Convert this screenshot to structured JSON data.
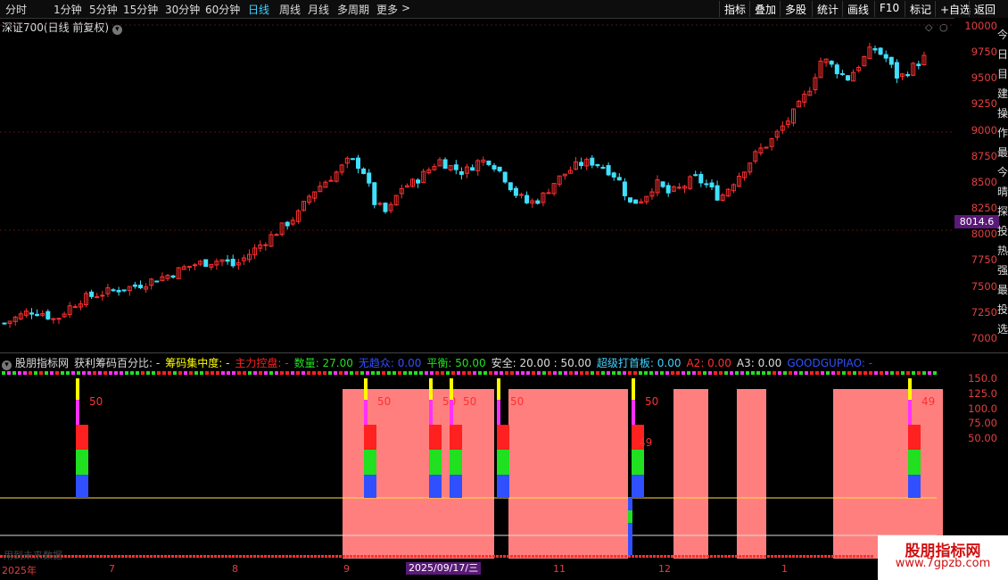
{
  "toolbar": {
    "periods": [
      "分时",
      "1分钟",
      "5分钟",
      "15分钟",
      "30分钟",
      "60分钟",
      "日线",
      "周线",
      "月线",
      "多周期",
      "更多"
    ],
    "more_arrow": ">",
    "active_period": "日线",
    "right_buttons": [
      "指标",
      "叠加",
      "多股",
      "统计",
      "画线",
      "F10",
      "标记",
      "+自选",
      "返回"
    ]
  },
  "main_chart": {
    "title": "深证700(日线 前复权)",
    "y_ticks": [
      "10000",
      "9750",
      "9500",
      "9250",
      "9000",
      "8750",
      "8500",
      "8250",
      "8000",
      "7750",
      "7500",
      "7250",
      "7000"
    ],
    "current_price": "8014.6",
    "side_glyphs": [
      "今",
      "日",
      "目",
      "建",
      "操",
      "作",
      "最",
      "今",
      "晴",
      "探",
      "投",
      "热",
      "强",
      "最",
      "投",
      "选"
    ]
  },
  "indicator": {
    "title_parts": [
      {
        "text": "股朋指标网",
        "color": "#dddddd"
      },
      {
        "text": "获利筹码百分比: -",
        "color": "#dddddd"
      },
      {
        "text": "筹码集中度: -",
        "color": "#ffff00"
      },
      {
        "text": "主力控盘: -",
        "color": "#ff2020"
      },
      {
        "text": "数量: 27.00",
        "color": "#20e020"
      },
      {
        "text": "无趋众: 0.00",
        "color": "#3050ff"
      },
      {
        "text": "平衡: 50.00",
        "color": "#20e020"
      },
      {
        "text": "安全: 20.00 : 50.00",
        "color": "#dddddd"
      },
      {
        "text": "超级打首板: 0.00",
        "color": "#3fd1ff"
      },
      {
        "text": "A2: 0.00",
        "color": "#ff3030"
      },
      {
        "text": "A3: 0.00",
        "color": "#dddddd"
      },
      {
        "text": "GOODGUPIAO: -",
        "color": "#3050ff"
      }
    ],
    "y_ticks": [
      "150.0",
      "125.0",
      "100.0",
      "75.00",
      "50.00"
    ],
    "bar_labels": [
      "50",
      "50",
      "50",
      "50",
      "50",
      "50",
      "49",
      "50"
    ],
    "faint_text": "用到未来数据"
  },
  "date_axis": {
    "labels": [
      "2025年",
      "7",
      "8",
      "9",
      "2025/09/17/三",
      "11",
      "12",
      "1"
    ],
    "highlight": "2025/09/17/三"
  },
  "watermark": {
    "line1": "股朋指标网",
    "line2": "www.7gpzb.com"
  },
  "chart_data": {
    "type": "candlestick",
    "y_range": [
      6930,
      10050
    ],
    "up_color": "#ff3030",
    "down_color": "#40e0ff",
    "close_series_approx": [
      7150,
      7210,
      7270,
      7250,
      7180,
      7300,
      7380,
      7420,
      7450,
      7480,
      7500,
      7540,
      7580,
      7620,
      7680,
      7720,
      7740,
      7760,
      7700,
      7800,
      7900,
      8000,
      8100,
      8200,
      8400,
      8500,
      8600,
      8720,
      8650,
      8300,
      8200,
      8450,
      8500,
      8600,
      8720,
      8650,
      8600,
      8700,
      8720,
      8580,
      8400,
      8300,
      8350,
      8500,
      8600,
      8680,
      8700,
      8650,
      8550,
      8300,
      8350,
      8500,
      8400,
      8450,
      8550,
      8480,
      8350,
      8500,
      8650,
      8800,
      8900,
      9050,
      9200,
      9400,
      9700,
      9600,
      9500,
      9650,
      9800,
      9700,
      9500,
      9600,
      9700
    ]
  }
}
